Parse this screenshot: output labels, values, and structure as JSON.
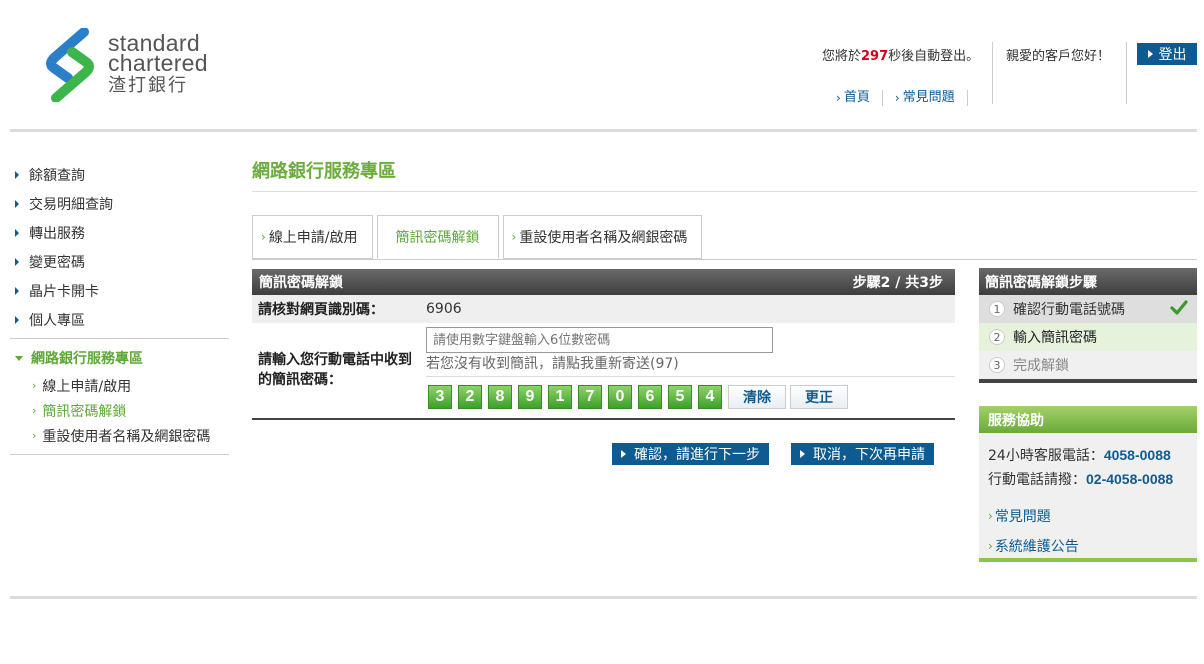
{
  "brand": {
    "line1": "standard",
    "line2": "chartered",
    "line3": "渣打銀行"
  },
  "header": {
    "countdown_prefix": "您將於",
    "countdown_seconds": "297",
    "countdown_suffix": "秒後自動登出。",
    "greeting": "親愛的客戶您好！",
    "logout_label": "登出",
    "links": [
      "首頁",
      "常見問題"
    ]
  },
  "sidebar": {
    "items": [
      "餘額查詢",
      "交易明細查詢",
      "轉出服務",
      "變更密碼",
      "晶片卡開卡",
      "個人專區"
    ],
    "section": {
      "label": "網路銀行服務專區",
      "subitems": [
        "線上申請/啟用",
        "簡訊密碼解鎖",
        "重設使用者名稱及網銀密碼"
      ]
    }
  },
  "main": {
    "title": "網路銀行服務專區",
    "tabs": [
      "線上申請/啟用",
      "簡訊密碼解鎖",
      "重設使用者名稱及網銀密碼"
    ],
    "panel": {
      "title": "簡訊密碼解鎖",
      "step_info": "步驟2 / 共3步",
      "id_label": "請核對網頁識別碼：",
      "id_value": "6906",
      "otp_label": "請輸入您行動電話中收到的簡訊密碼：",
      "otp_placeholder": "請使用數字鍵盤輸入6位數密碼",
      "resend_text": "若您沒有收到簡訊，請點我重新寄送(97)",
      "keypad": [
        "3",
        "2",
        "8",
        "9",
        "1",
        "7",
        "0",
        "6",
        "5",
        "4"
      ],
      "clear_label": "清除",
      "correct_label": "更正"
    },
    "confirm_label": "確認，請進行下一步",
    "cancel_label": "取消，下次再申請"
  },
  "steps_box": {
    "title": "簡訊密碼解鎖步驟",
    "steps": [
      {
        "num": "1",
        "label": "確認行動電話號碼"
      },
      {
        "num": "2",
        "label": "輸入簡訊密碼"
      },
      {
        "num": "3",
        "label": "完成解鎖"
      }
    ]
  },
  "help_box": {
    "title": "服務協助",
    "hotline_label": "24小時客服電話：",
    "hotline": "4058-0088",
    "mobile_label": "行動電話請撥：",
    "mobile": "02-4058-0088",
    "links": [
      "常見問題",
      "系統維護公告"
    ]
  },
  "colors": {
    "brand_blue": "#0e5b91",
    "brand_green": "#5ea83a",
    "countdown_red": "#d0021b"
  },
  "icons": [
    "standard-chartered-logo",
    "checkmark-icon",
    "triangle-right-icon",
    "chevron-right-icon"
  ]
}
